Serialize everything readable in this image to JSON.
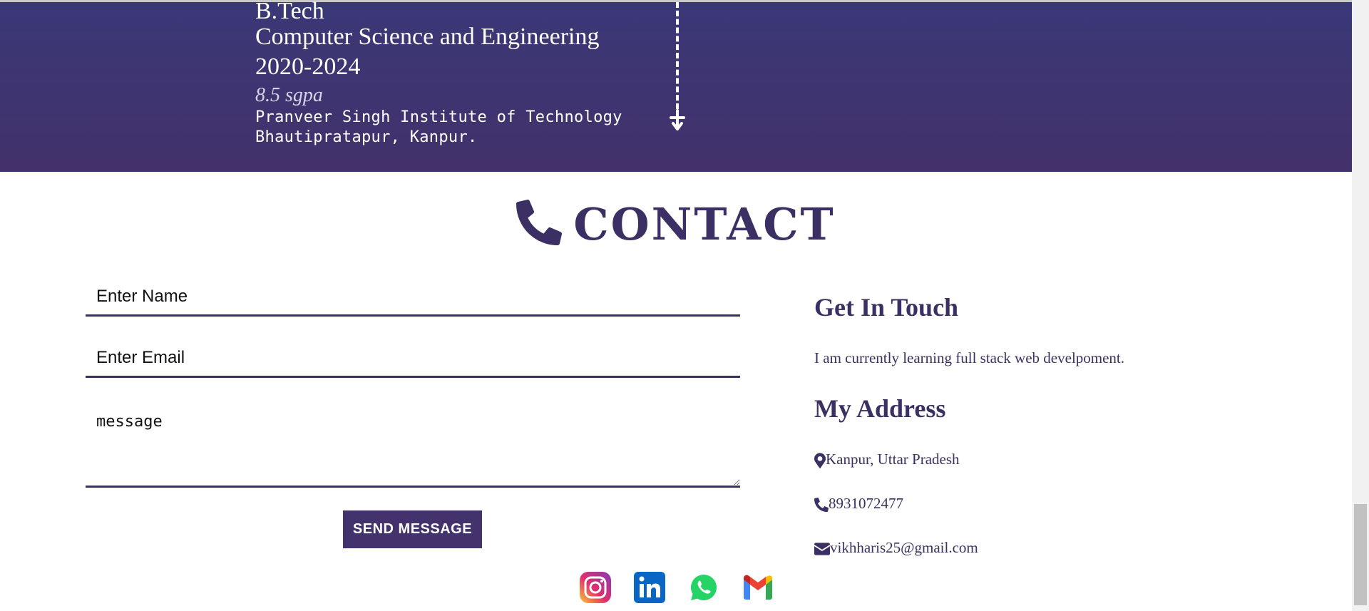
{
  "education": {
    "degree": "B.Tech",
    "branch": "Computer Science and Engineering",
    "years": "2020-2024",
    "grade": "8.5 sgpa",
    "institute_line1": "Pranveer Singh Institute of Technology",
    "institute_line2": "Bhautipratapur, Kanpur."
  },
  "contact": {
    "heading": "CONTACT",
    "form": {
      "name_placeholder": "Enter Name",
      "email_placeholder": "Enter Email",
      "message_placeholder": "message",
      "send_label": "SEND MESSAGE"
    },
    "aside": {
      "get_in_touch_title": "Get In Touch",
      "intro": "I am currently learning full stack web develpoment.",
      "address_title": "My Address",
      "location": "Kanpur, Uttar Pradesh",
      "phone": "8931072477",
      "email": "vikhharis25@gmail.com"
    },
    "socials": [
      "instagram-icon",
      "linkedin-icon",
      "whatsapp-icon",
      "gmail-icon"
    ]
  },
  "colors": {
    "band_top": "#3a3877",
    "band_bottom": "#42316b",
    "accent": "#3b2f63",
    "button": "#43326b"
  }
}
